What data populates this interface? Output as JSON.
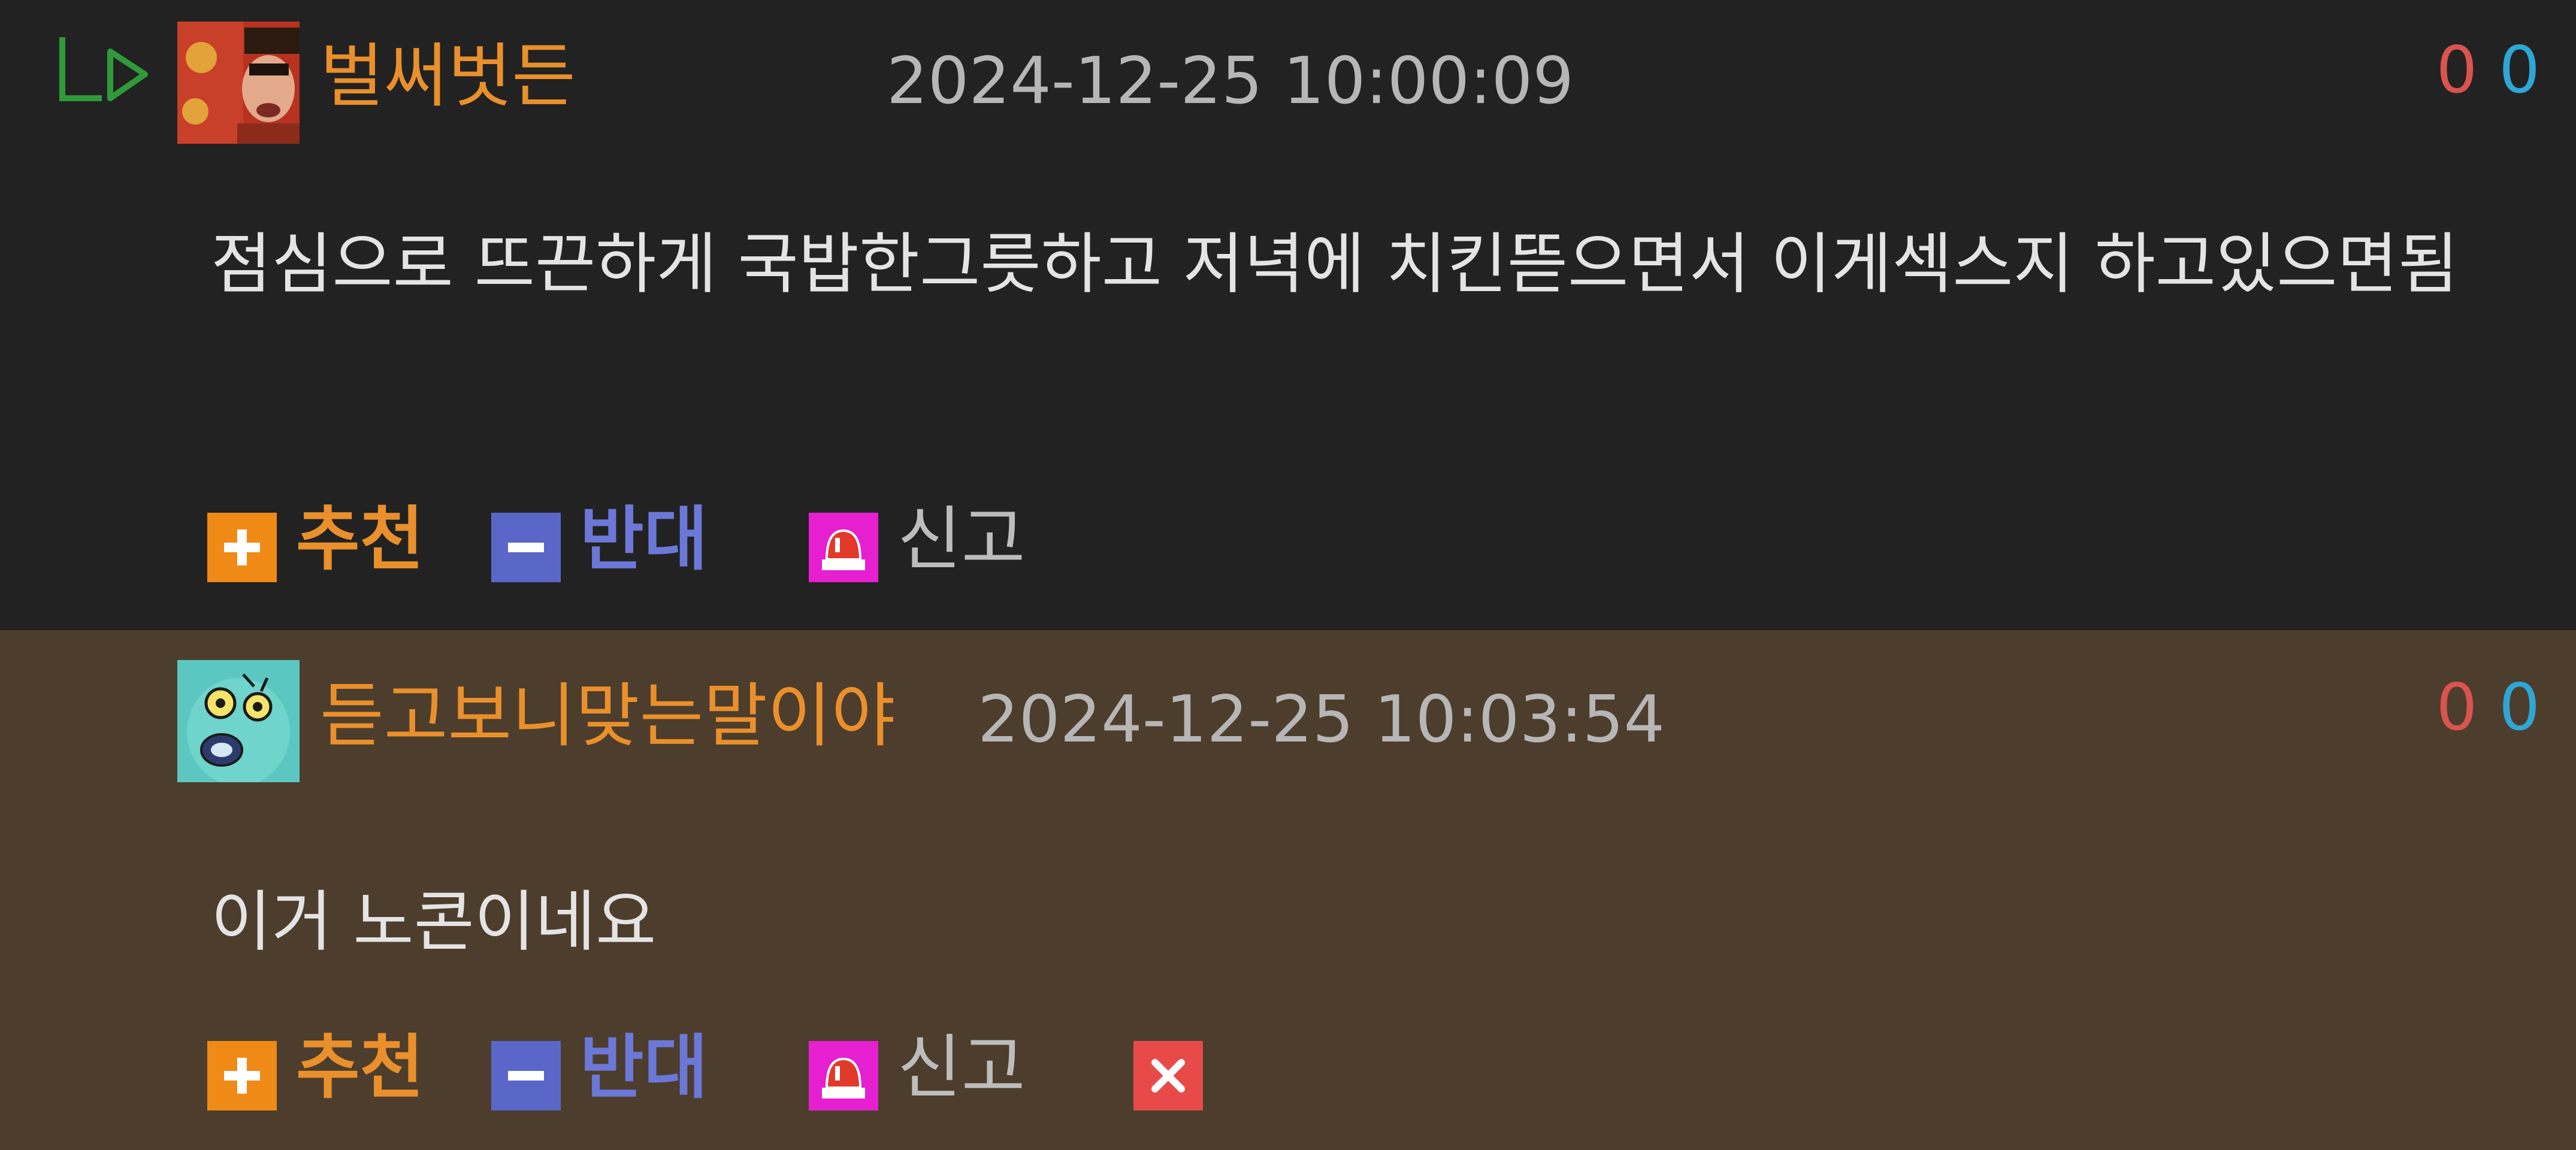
{
  "comments": [
    {
      "nickname": "벌써벗든",
      "timestamp": "2024-12-25 10:00:09",
      "upvotes": "0",
      "downvotes": "0",
      "body": "점심으로 뜨끈하게 국밥한그릇하고 저녁에 치킨뜯으면서 이게섹스지 하고있으면됨",
      "actions": {
        "recommend": "추천",
        "oppose": "반대",
        "report": "신고"
      }
    },
    {
      "nickname": "듣고보니맞는말이야",
      "timestamp": "2024-12-25 10:03:54",
      "upvotes": "0",
      "downvotes": "0",
      "body": "이거 노콘이네요",
      "actions": {
        "recommend": "추천",
        "oppose": "반대",
        "report": "신고"
      }
    }
  ],
  "icons": {
    "reply": "reply-arrow-icon",
    "recommend": "plus-icon",
    "oppose": "minus-icon",
    "report": "siren-icon",
    "delete": "close-icon"
  },
  "colors": {
    "comment_bg_1": "#222222",
    "comment_bg_2": "#4d3d2c",
    "nickname": "#e9902c",
    "upvote": "#d9534f",
    "downvote": "#2ea6d6",
    "recommend": "#f08a16",
    "oppose": "#5a67c9",
    "report": "#e61fd0",
    "delete": "#e84a4a"
  }
}
